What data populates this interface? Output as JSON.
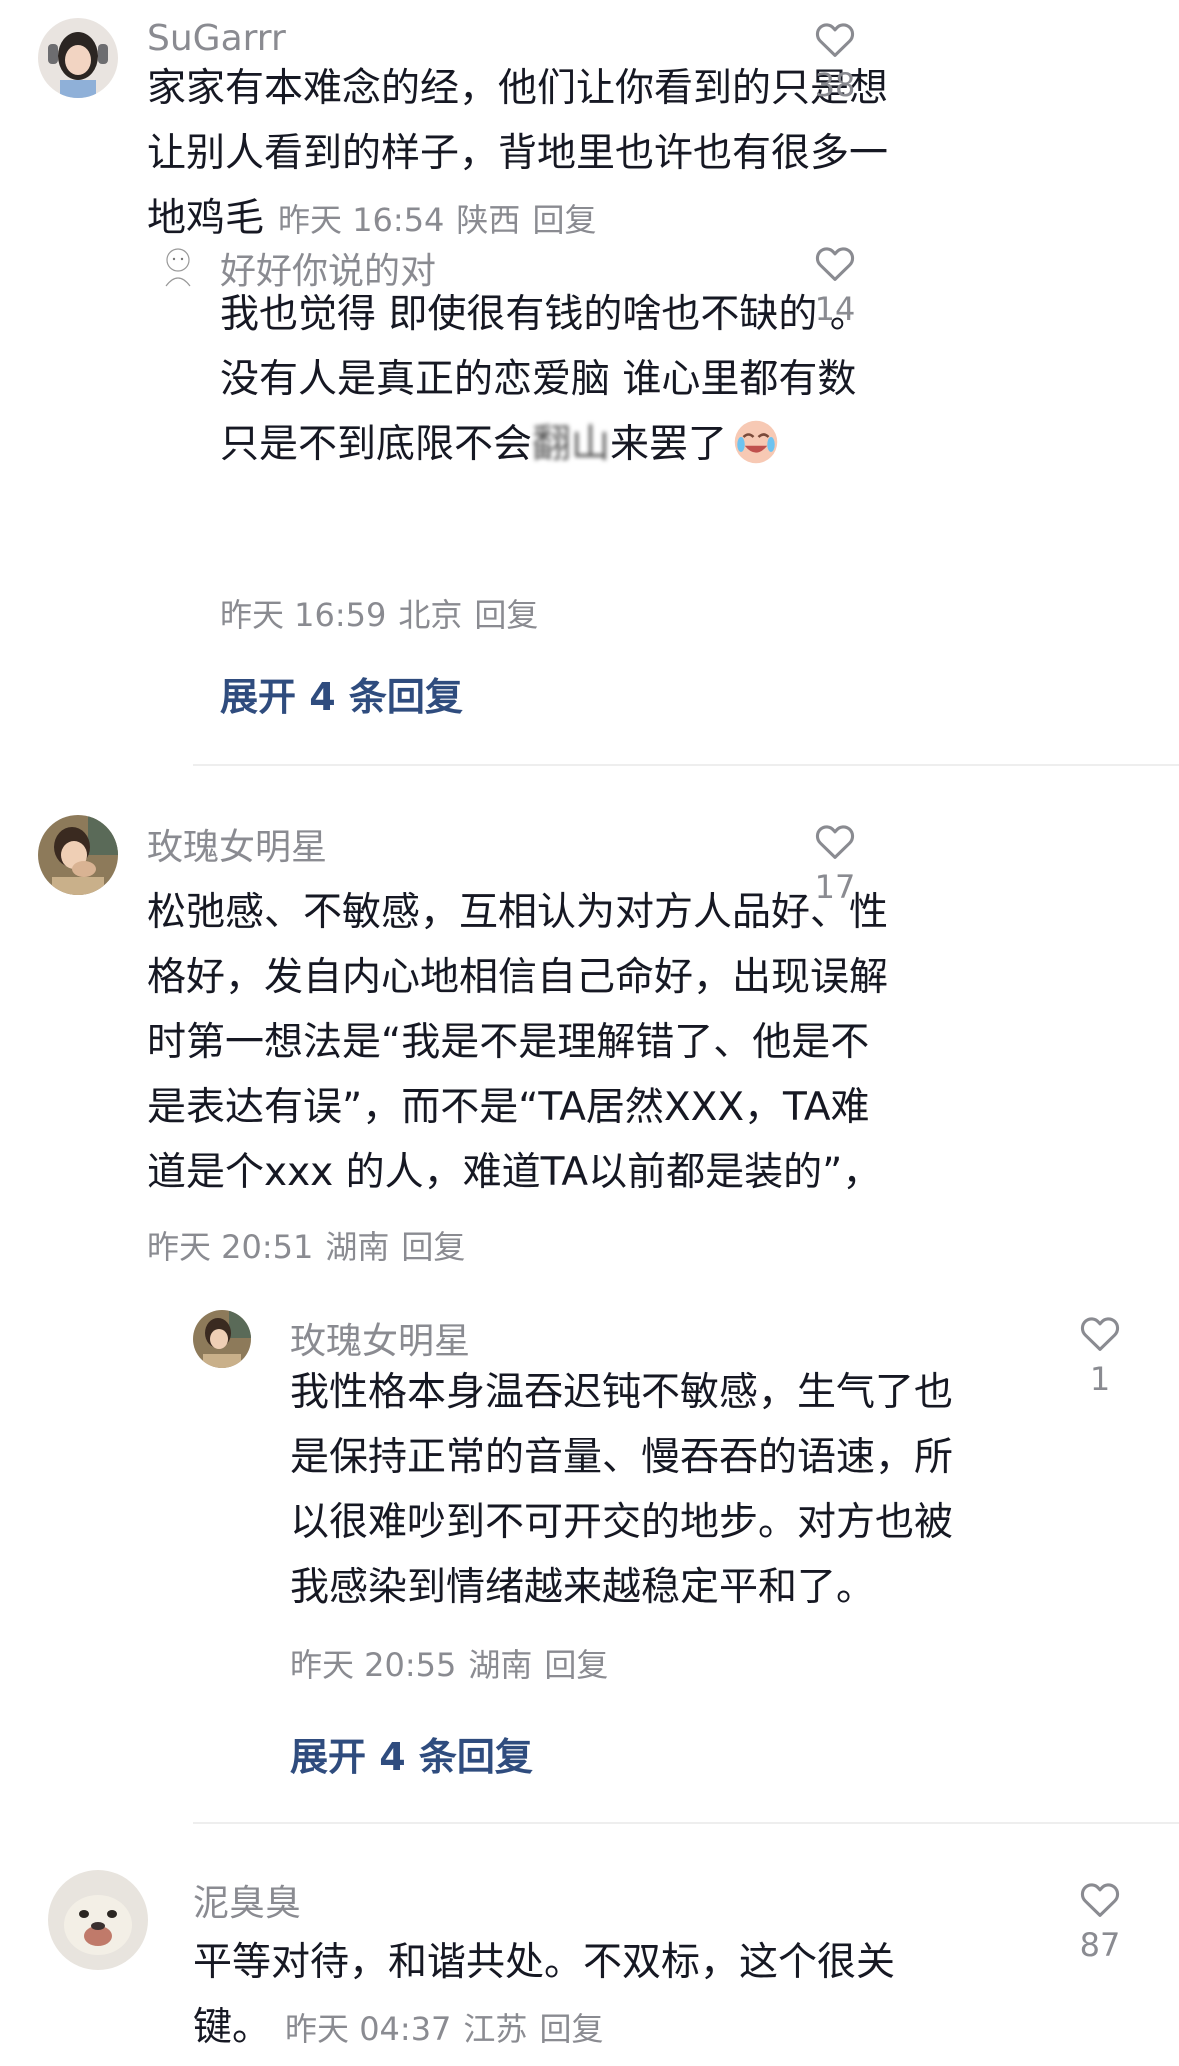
{
  "comments": [
    {
      "username": "SuGarrr",
      "lines": [
        "家家有本难念的经，他们让你看到的只是想",
        "让别人看到的样子，背地里也许也有很多一",
        "地鸡毛"
      ],
      "time": "昨天 16:54",
      "location": "陕西",
      "reply_label": "回复",
      "likes": "38",
      "replies": [
        {
          "username": "好好你说的对",
          "lines": [
            "我也觉得 即使很有钱的啥也不缺的 。",
            "没有人是真正的恋爱脑 谁心里都有数",
            "只是不到底限不会",
            "来罢了"
          ],
          "blurred_text": "翻山",
          "time": "昨天 16:59",
          "location": "北京",
          "reply_label": "回复",
          "likes": "14"
        }
      ],
      "expand_label": "展开 4 条回复"
    },
    {
      "username": "玫瑰女明星",
      "lines": [
        "松弛感、不敏感，互相认为对方人品好、性",
        "格好，发自内心地相信自己命好，出现误解",
        "时第一想法是“我是不是理解错了、他是不",
        "是表达有误”，而不是“TA居然XXX，TA难",
        "道是个xxx 的人，难道TA以前都是装的”，"
      ],
      "time": "昨天 20:51",
      "location": "湖南",
      "reply_label": "回复",
      "likes": "17",
      "replies": [
        {
          "username": "玫瑰女明星",
          "lines": [
            "我性格本身温吞迟钝不敏感，生气了也",
            "是保持正常的音量、慢吞吞的语速，所",
            "以很难吵到不可开交的地步。对方也被",
            "我感染到情绪越来越稳定平和了。"
          ],
          "time": "昨天 20:55",
          "location": "湖南",
          "reply_label": "回复",
          "likes": "1"
        }
      ],
      "expand_label": "展开 4 条回复"
    },
    {
      "username": "泥臭臭",
      "lines": [
        "平等对待，和谐共处。不双标，这个很关",
        "键。"
      ],
      "time": "昨天 04:37",
      "location": "江苏",
      "reply_label": "回复",
      "likes": "87"
    }
  ],
  "colors": {
    "text": "#161823",
    "secondary": "#8a8b91",
    "expand_link": "#2f4c7e",
    "divider": "#eeeeee"
  },
  "icons": {
    "like": "heart-outline-icon",
    "emoji": "crying-laughing-emoji-icon"
  }
}
